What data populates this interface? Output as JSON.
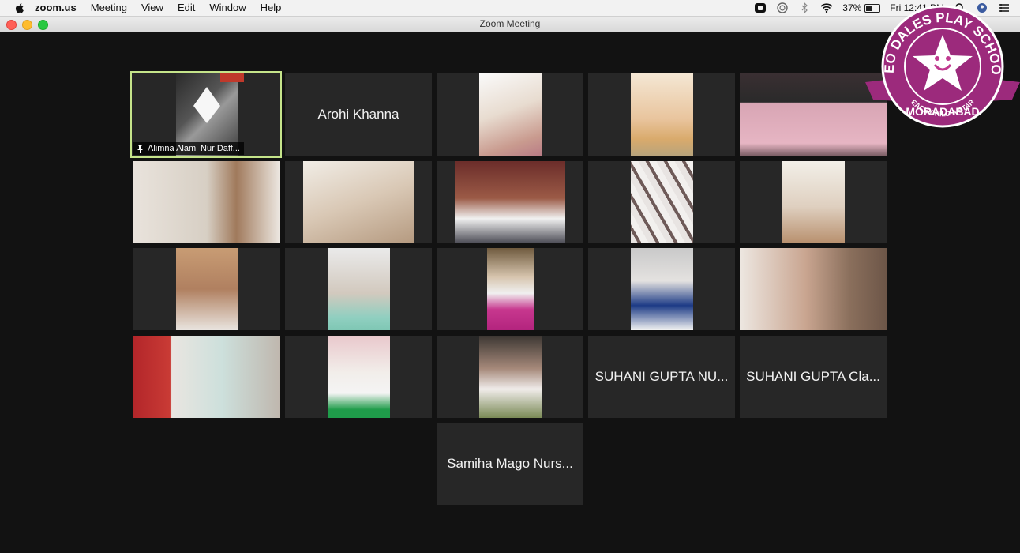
{
  "menubar": {
    "app_name": "zoom.us",
    "menus": [
      "Meeting",
      "View",
      "Edit",
      "Window",
      "Help"
    ],
    "battery_percent": "37%",
    "clock": "Fri 12:41 PM",
    "icons": [
      "apple-icon",
      "screen-share-icon",
      "focus-icon",
      "bluetooth-icon",
      "wifi-icon",
      "battery-icon",
      "search-icon",
      "user-icon",
      "control-center-icon"
    ]
  },
  "window": {
    "title": "Zoom Meeting"
  },
  "gallery": {
    "active_speaker_name": "Alimna Alam| Nur Daff...",
    "named_tiles": {
      "arohi": "Arohi Khanna",
      "suhani_nu": "SUHANI GUPTA NU...",
      "suhani_cla": "SUHANI GUPTA Cla...",
      "samiha": "Samiha Mago Nurs..."
    }
  },
  "logo": {
    "text_top": "NEO DALES PLAY SCHOOL",
    "text_tagline": "EACH CHILD A STAR",
    "text_bottom": "MORADABAD",
    "color": "#9c2a7c"
  }
}
